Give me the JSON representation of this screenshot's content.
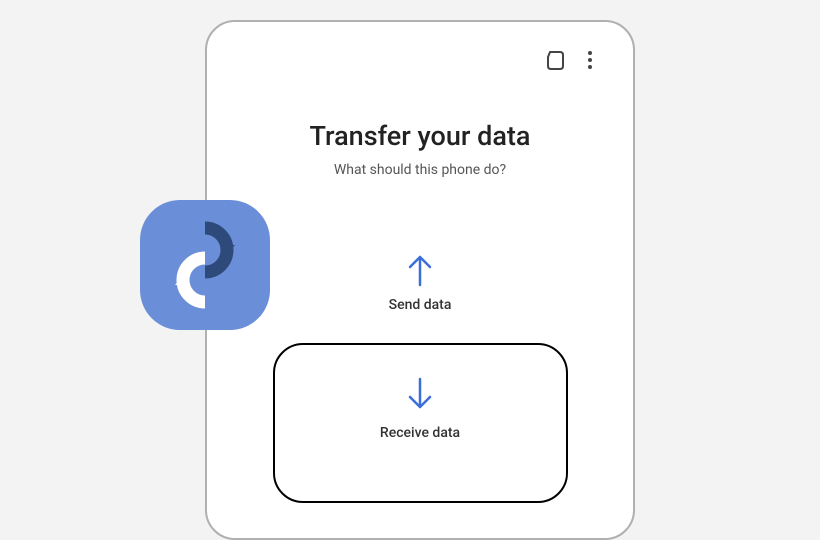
{
  "header": {
    "title": "Transfer your data",
    "subtitle": "What should this phone do?"
  },
  "options": {
    "send": {
      "label": "Send data"
    },
    "receive": {
      "label": "Receive data"
    }
  },
  "colors": {
    "accent": "#3a6fd8",
    "app_icon_bg": "#6a8fd8"
  },
  "icons": {
    "top_right_1": "sd-card-icon",
    "top_right_2": "more-vertical-icon",
    "app": "smart-switch-icon"
  }
}
